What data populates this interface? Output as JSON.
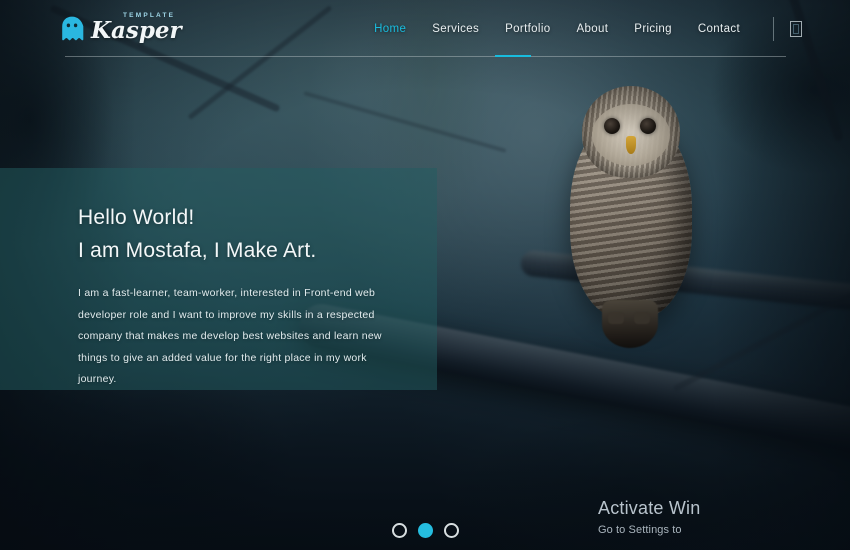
{
  "site": {
    "logo": {
      "icon": "ghost-icon",
      "template_label": "TEMPLATE",
      "brand": "Kasper",
      "brand_color": "#ffffff",
      "icon_color": "#2ab7e0"
    },
    "nav": {
      "items": [
        {
          "label": "Home",
          "active": true
        },
        {
          "label": "Services",
          "active": false
        },
        {
          "label": "Portfolio",
          "active": false
        },
        {
          "label": "About",
          "active": false
        },
        {
          "label": "Pricing",
          "active": false
        },
        {
          "label": "Contact",
          "active": false
        }
      ],
      "active_color": "#18bcde",
      "search_icon": "search-icon"
    }
  },
  "hero": {
    "heading_line1": "Hello World!",
    "heading_line2": "I am Mostafa, I Make Art.",
    "paragraph": "I am a fast-learner, team-worker, interested in Front-end web developer role and I want to improve my skills in a respected company that makes me develop best websites and learn new things to give an added value for the right place in my work journey.",
    "panel_color": "#225c60"
  },
  "slider": {
    "bullets": [
      {
        "active": false
      },
      {
        "active": true
      },
      {
        "active": false
      }
    ],
    "active_color": "#25bddf"
  },
  "watermark": {
    "title": "Activate Win",
    "subtitle": "Go to Settings to"
  }
}
